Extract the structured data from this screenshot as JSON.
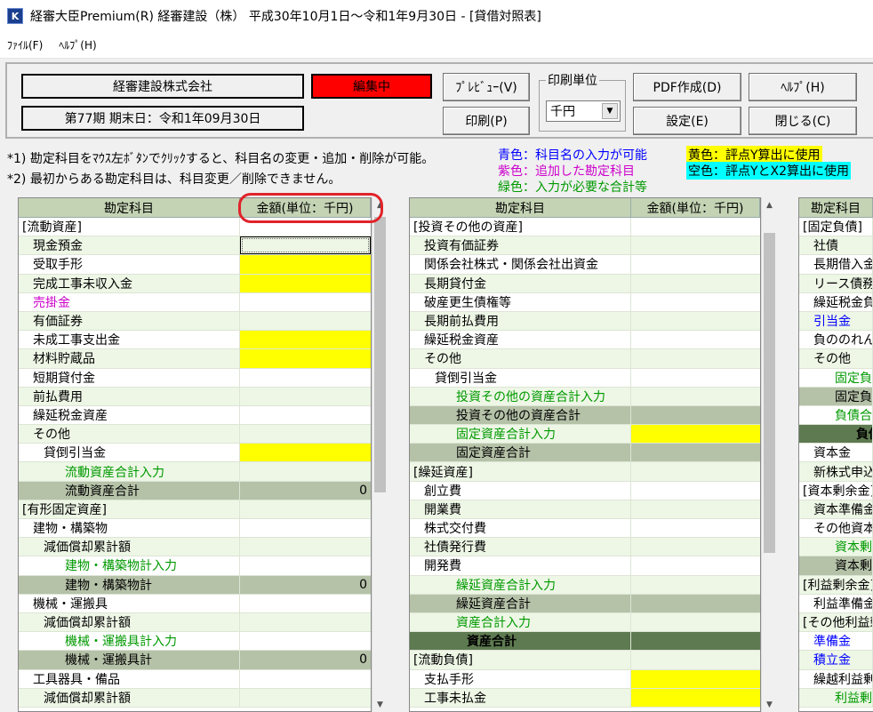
{
  "window": {
    "title": "経審大臣Premium(R)  経審建設（株）   平成30年10月1日～令和1年9月30日 - [貸借対照表]",
    "icon": "K"
  },
  "menu": [
    "ﾌｧｲﾙ(F)",
    "ﾍﾙﾌﾟ(H)"
  ],
  "toolbar": {
    "company": "経審建設株式会社",
    "period": "第77期    期末日：令和1年09月30日",
    "status": "編集中",
    "status_color": "#ff0000",
    "preview": "ﾌﾟﾚﾋﾞｭｰ(V)",
    "print": "印刷(P)",
    "unit_group": "印刷単位",
    "unit_value": "千円",
    "pdf": "PDF作成(D)",
    "settings": "設定(E)",
    "help": "ﾍﾙﾌﾟ(H)",
    "close": "閉じる(C)"
  },
  "notes": {
    "n1": "*1) 勘定科目をﾏｳｽ左ﾎﾞﾀﾝでｸﾘｯｸすると、科目名の変更・追加・削除が可能。",
    "n2": "*2) 最初からある勘定科目は、科目変更／削除できません。",
    "blue": "青色：科目名の入力が可能",
    "purple": "紫色：追加した勘定科目",
    "green": "緑色：入力が必要な合計等",
    "yellow": "黄色：評点Y算出に使用",
    "cyan": "空色：評点YとX2算出に使用"
  },
  "colors": {
    "yellow": "#ffff00",
    "cyan": "#00ffff",
    "blue": "#0000ff",
    "purple": "#cc00cc",
    "green": "#009900",
    "section": "#c4d3b4",
    "subtotal": "#b5c2a8",
    "total": "#5e7a50",
    "rowbg": "#eef7e6"
  },
  "headers": {
    "account": "勘定科目",
    "amount": "金額(単位：千円)"
  },
  "panel1": [
    {
      "name": "[流動資産]",
      "ind": 0,
      "type": "head"
    },
    {
      "name": "現金預金",
      "ind": 1,
      "cell": "sel"
    },
    {
      "name": "受取手形",
      "ind": 1,
      "cell": "y"
    },
    {
      "name": "完成工事未収入金",
      "ind": 1,
      "cell": "y"
    },
    {
      "name": "売掛金",
      "ind": 1,
      "col": "purple"
    },
    {
      "name": "有価証券",
      "ind": 1
    },
    {
      "name": "未成工事支出金",
      "ind": 1,
      "cell": "y"
    },
    {
      "name": "材料貯蔵品",
      "ind": 1,
      "cell": "y"
    },
    {
      "name": "短期貸付金",
      "ind": 1
    },
    {
      "name": "前払費用",
      "ind": 1
    },
    {
      "name": "繰延税金資産",
      "ind": 1
    },
    {
      "name": "その他",
      "ind": 1
    },
    {
      "name": "貸倒引当金",
      "ind": 2,
      "cell": "y"
    },
    {
      "name": "流動資産合計入力",
      "ind": 4,
      "col": "green"
    },
    {
      "name": "流動資産合計",
      "ind": 4,
      "type": "sub",
      "amt": "0"
    },
    {
      "name": "[有形固定資産]",
      "ind": 0,
      "type": "head"
    },
    {
      "name": "建物・構築物",
      "ind": 1
    },
    {
      "name": "減価償却累計額",
      "ind": 2
    },
    {
      "name": "建物・構築物計入力",
      "ind": 4,
      "col": "green"
    },
    {
      "name": "建物・構築物計",
      "ind": 4,
      "type": "sub",
      "amt": "0"
    },
    {
      "name": "機械・運搬具",
      "ind": 1
    },
    {
      "name": "減価償却累計額",
      "ind": 2
    },
    {
      "name": "機械・運搬具計入力",
      "ind": 4,
      "col": "green"
    },
    {
      "name": "機械・運搬具計",
      "ind": 4,
      "type": "sub",
      "amt": "0"
    },
    {
      "name": "工具器具・備品",
      "ind": 1
    },
    {
      "name": "減価償却累計額",
      "ind": 2
    }
  ],
  "panel2": [
    {
      "name": "[投資その他の資産]",
      "ind": 0,
      "type": "head"
    },
    {
      "name": "投資有価証券",
      "ind": 1
    },
    {
      "name": "関係会社株式・関係会社出資金",
      "ind": 1
    },
    {
      "name": "長期貸付金",
      "ind": 1
    },
    {
      "name": "破産更生債権等",
      "ind": 1
    },
    {
      "name": "長期前払費用",
      "ind": 1
    },
    {
      "name": "繰延税金資産",
      "ind": 1
    },
    {
      "name": "その他",
      "ind": 1
    },
    {
      "name": "貸倒引当金",
      "ind": 2
    },
    {
      "name": "投資その他の資産合計入力",
      "ind": 4,
      "col": "green"
    },
    {
      "name": "投資その他の資産合計",
      "ind": 4,
      "type": "sub"
    },
    {
      "name": "固定資産合計入力",
      "ind": 4,
      "col": "green",
      "cell": "y"
    },
    {
      "name": "固定資産合計",
      "ind": 4,
      "type": "sub"
    },
    {
      "name": "[繰延資産]",
      "ind": 0,
      "type": "head"
    },
    {
      "name": "創立費",
      "ind": 1
    },
    {
      "name": "開業費",
      "ind": 1
    },
    {
      "name": "株式交付費",
      "ind": 1
    },
    {
      "name": "社債発行費",
      "ind": 1
    },
    {
      "name": "開発費",
      "ind": 1
    },
    {
      "name": "繰延資産合計入力",
      "ind": 4,
      "col": "green"
    },
    {
      "name": "繰延資産合計",
      "ind": 4,
      "type": "sub"
    },
    {
      "name": "資産合計入力",
      "ind": 4,
      "col": "green"
    },
    {
      "name": "資産合計",
      "ind": 5,
      "type": "total"
    },
    {
      "name": "[流動負債]",
      "ind": 0,
      "type": "head"
    },
    {
      "name": "支払手形",
      "ind": 1,
      "cell": "y"
    },
    {
      "name": "工事未払金",
      "ind": 1,
      "cell": "y"
    }
  ],
  "panel3": [
    {
      "name": "[固定負債]",
      "ind": 0,
      "type": "head"
    },
    {
      "name": "社債",
      "ind": 1
    },
    {
      "name": "長期借入金",
      "ind": 1
    },
    {
      "name": "リース債務",
      "ind": 1
    },
    {
      "name": "繰延税金負債",
      "ind": 1
    },
    {
      "name": "引当金",
      "ind": 1,
      "col": "blue"
    },
    {
      "name": "負ののれん",
      "ind": 1
    },
    {
      "name": "その他",
      "ind": 1
    },
    {
      "name": "固定負債合計入力",
      "ind": 3,
      "col": "green"
    },
    {
      "name": "固定負債合計",
      "ind": 3,
      "type": "sub"
    },
    {
      "name": "負債合計入力",
      "ind": 3,
      "col": "green"
    },
    {
      "name": "負債合計",
      "ind": 5,
      "type": "total"
    },
    {
      "name": "資本金",
      "ind": 1
    },
    {
      "name": "新株式申込証拠金",
      "ind": 1
    },
    {
      "name": "[資本剰余金]",
      "ind": 0,
      "type": "head"
    },
    {
      "name": "資本準備金",
      "ind": 1
    },
    {
      "name": "その他資本剰余金",
      "ind": 1
    },
    {
      "name": "資本剰余金合計入力",
      "ind": 3,
      "col": "green"
    },
    {
      "name": "資本剰余金合計",
      "ind": 3,
      "type": "sub"
    },
    {
      "name": "[利益剰余金]",
      "ind": 0,
      "type": "head"
    },
    {
      "name": "利益準備金",
      "ind": 1
    },
    {
      "name": "[その他利益剰余金]",
      "ind": 0,
      "type": "head"
    },
    {
      "name": "準備金",
      "ind": 1,
      "col": "blue"
    },
    {
      "name": "積立金",
      "ind": 1,
      "col": "blue"
    },
    {
      "name": "繰越利益剰余金",
      "ind": 1
    },
    {
      "name": "利益剰余金合計入力",
      "ind": 3,
      "col": "green"
    }
  ]
}
